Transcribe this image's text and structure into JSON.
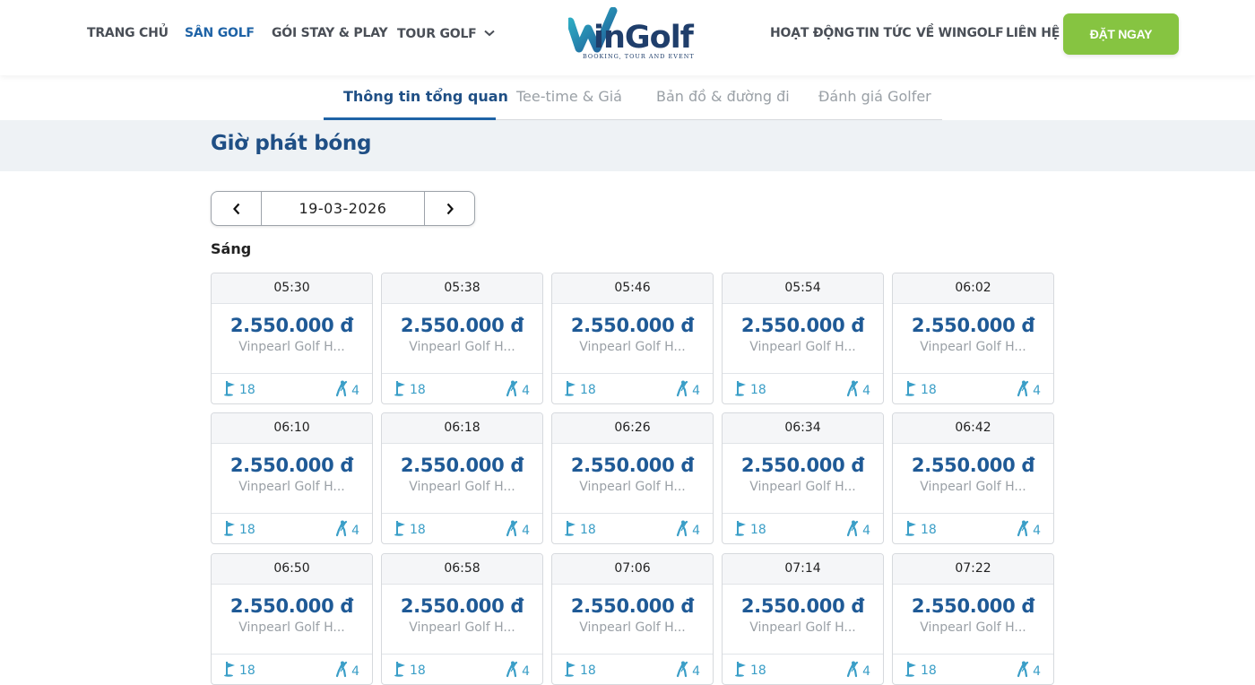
{
  "nav": {
    "left": [
      {
        "label": "TRANG CHỦ",
        "active": false
      },
      {
        "label": "SÂN GOLF",
        "active": true
      },
      {
        "label": "GÓI STAY & PLAY",
        "active": false
      },
      {
        "label": "TOUR GOLF",
        "active": false,
        "dropdown": true
      }
    ],
    "right": [
      {
        "label": "HOẠT ĐỘNG"
      },
      {
        "label": "TIN TỨC"
      },
      {
        "label": "VỀ WINGOLF"
      },
      {
        "label": "LIÊN HỆ"
      }
    ],
    "cta_label": "ĐẶT NGAY"
  },
  "logo": {
    "wordmark": "inGolf",
    "tagline": "BOOKING, TOUR AND EVENT"
  },
  "tabs": [
    {
      "label": "Thông tin tổng quan",
      "active": true
    },
    {
      "label": "Tee-time & Giá",
      "active": false
    },
    {
      "label": "Bản đồ & đường đi",
      "active": false
    },
    {
      "label": "Đánh giá Golfer",
      "active": false
    }
  ],
  "section_title": "Giờ phát bóng",
  "date_picker": {
    "date": "19-03-2026"
  },
  "session_label": "Sáng",
  "tee_times": [
    {
      "time": "05:30",
      "price": "2.550.000 đ",
      "course": "Vinpearl Golf H...",
      "holes": "18",
      "players": "4"
    },
    {
      "time": "05:38",
      "price": "2.550.000 đ",
      "course": "Vinpearl Golf H...",
      "holes": "18",
      "players": "4"
    },
    {
      "time": "05:46",
      "price": "2.550.000 đ",
      "course": "Vinpearl Golf H...",
      "holes": "18",
      "players": "4"
    },
    {
      "time": "05:54",
      "price": "2.550.000 đ",
      "course": "Vinpearl Golf H...",
      "holes": "18",
      "players": "4"
    },
    {
      "time": "06:02",
      "price": "2.550.000 đ",
      "course": "Vinpearl Golf H...",
      "holes": "18",
      "players": "4"
    },
    {
      "time": "06:10",
      "price": "2.550.000 đ",
      "course": "Vinpearl Golf H...",
      "holes": "18",
      "players": "4"
    },
    {
      "time": "06:18",
      "price": "2.550.000 đ",
      "course": "Vinpearl Golf H...",
      "holes": "18",
      "players": "4"
    },
    {
      "time": "06:26",
      "price": "2.550.000 đ",
      "course": "Vinpearl Golf H...",
      "holes": "18",
      "players": "4"
    },
    {
      "time": "06:34",
      "price": "2.550.000 đ",
      "course": "Vinpearl Golf H...",
      "holes": "18",
      "players": "4"
    },
    {
      "time": "06:42",
      "price": "2.550.000 đ",
      "course": "Vinpearl Golf H...",
      "holes": "18",
      "players": "4"
    },
    {
      "time": "06:50",
      "price": "2.550.000 đ",
      "course": "Vinpearl Golf H...",
      "holes": "18",
      "players": "4"
    },
    {
      "time": "06:58",
      "price": "2.550.000 đ",
      "course": "Vinpearl Golf H...",
      "holes": "18",
      "players": "4"
    },
    {
      "time": "07:06",
      "price": "2.550.000 đ",
      "course": "Vinpearl Golf H...",
      "holes": "18",
      "players": "4"
    },
    {
      "time": "07:14",
      "price": "2.550.000 đ",
      "course": "Vinpearl Golf H...",
      "holes": "18",
      "players": "4"
    },
    {
      "time": "07:22",
      "price": "2.550.000 đ",
      "course": "Vinpearl Golf H...",
      "holes": "18",
      "players": "4"
    }
  ],
  "colors": {
    "brand_blue": "#1f63a6",
    "price_blue": "#1f5a96",
    "cta_green": "#86c441",
    "icon_teal": "#3a9ec7"
  }
}
